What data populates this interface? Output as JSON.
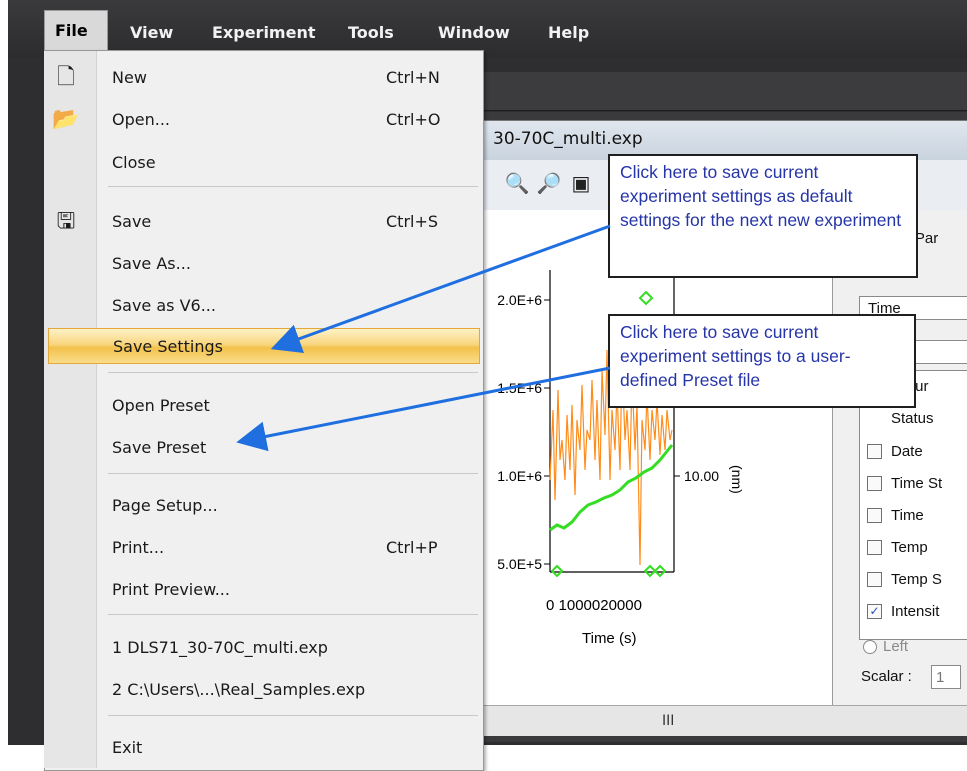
{
  "menubar": {
    "items": [
      "File",
      "View",
      "Experiment",
      "Tools",
      "Window",
      "Help"
    ]
  },
  "document": {
    "title": "30-70C_multi.exp"
  },
  "file_menu": {
    "items": [
      {
        "label": "New",
        "shortcut": "Ctrl+N",
        "icon": "new-file-icon"
      },
      {
        "label": "Open...",
        "shortcut": "Ctrl+O",
        "icon": "open-folder-icon"
      },
      {
        "label": "Close",
        "shortcut": ""
      },
      {
        "label": "Save",
        "shortcut": "Ctrl+S",
        "icon": "save-disk-icon"
      },
      {
        "label": "Save As...",
        "shortcut": ""
      },
      {
        "label": "Save as V6...",
        "shortcut": ""
      },
      {
        "label": "Save Settings",
        "shortcut": "",
        "highlighted": true
      },
      {
        "label": "Open Preset",
        "shortcut": ""
      },
      {
        "label": "Save Preset",
        "shortcut": ""
      },
      {
        "label": "Page Setup...",
        "shortcut": ""
      },
      {
        "label": "Print...",
        "shortcut": "Ctrl+P"
      },
      {
        "label": "Print Preview...",
        "shortcut": ""
      },
      {
        "label": "1 DLS71_30-70C_multi.exp",
        "shortcut": ""
      },
      {
        "label": "2 C:\\Users\\...\\Real_Samples.exp",
        "shortcut": ""
      },
      {
        "label": "Exit",
        "shortcut": ""
      }
    ]
  },
  "callouts": {
    "save_settings": "Click here to save current experiment settings as default settings for the next new experiment",
    "save_preset": "Click here to save current experiment settings to a user-defined Preset file"
  },
  "plot": {
    "y_ticks": [
      "2.0E+6",
      "1.5E+6",
      "1.0E+6",
      "5.0E+5"
    ],
    "x_ticks": "0 1000020000",
    "xlabel": "Time (s)",
    "right_tick": "10.00",
    "right_label": "(nm)",
    "series_colors": [
      "#ff8c1a",
      "#33dd22"
    ]
  },
  "right_panel": {
    "header": "ol Par",
    "field1": "Time",
    "items": [
      {
        "label": "easur",
        "checked": false
      },
      {
        "label": "Status",
        "checked": false
      },
      {
        "label": "Date",
        "checked": false
      },
      {
        "label": "Time St",
        "checked": false
      },
      {
        "label": "Time",
        "checked": false
      },
      {
        "label": "Temp",
        "checked": false
      },
      {
        "label": "Temp S",
        "checked": false
      },
      {
        "label": "Intensit",
        "checked": true
      }
    ],
    "radio_left": "Left",
    "scalar_label": "Scalar :",
    "scalar_value": "1"
  },
  "scrollbar": {
    "thumb": "III"
  },
  "colors": {
    "accent_callout_text": "#2534a8",
    "arrow": "#1f6fe0",
    "highlight": "#f3c24c"
  }
}
